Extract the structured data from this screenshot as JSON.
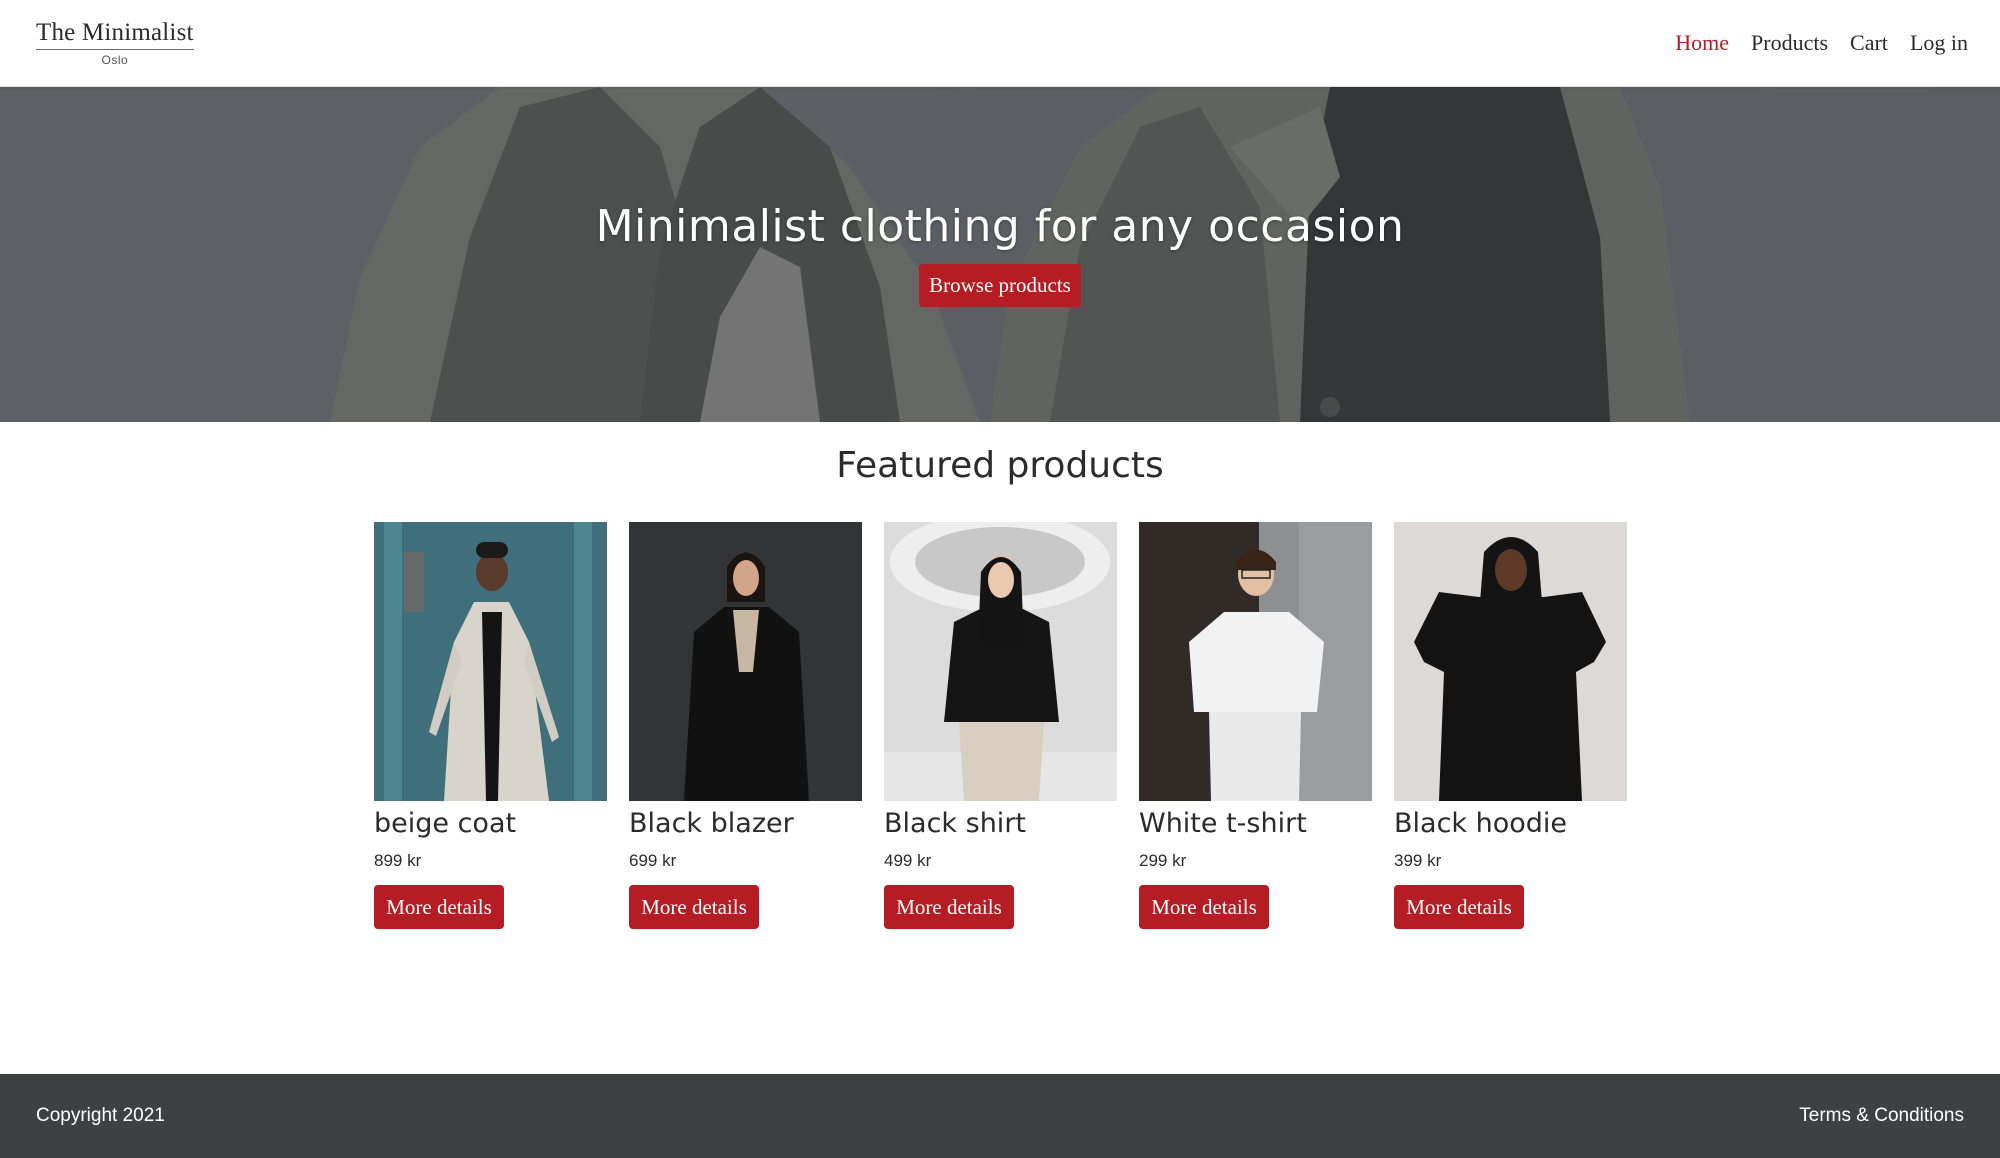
{
  "header": {
    "logo_name": "The Minimalist",
    "logo_city": "Oslo",
    "nav": [
      {
        "label": "Home",
        "active": true
      },
      {
        "label": "Products",
        "active": false
      },
      {
        "label": "Cart",
        "active": false
      },
      {
        "label": "Log in",
        "active": false
      }
    ]
  },
  "hero": {
    "title": "Minimalist clothing for any occasion",
    "button_label": "Browse products"
  },
  "featured": {
    "title": "Featured products",
    "products": [
      {
        "name": "beige coat",
        "price": "899 kr",
        "button_label": "More details"
      },
      {
        "name": "Black blazer",
        "price": "699 kr",
        "button_label": "More details"
      },
      {
        "name": "Black shirt",
        "price": "499 kr",
        "button_label": "More details"
      },
      {
        "name": "White t-shirt",
        "price": "299 kr",
        "button_label": "More details"
      },
      {
        "name": "Black hoodie",
        "price": "399 kr",
        "button_label": "More details"
      }
    ]
  },
  "footer": {
    "copyright": "Copyright 2021",
    "terms_label": "Terms & Conditions"
  },
  "colors": {
    "accent": "#b51c24",
    "footer_bg": "#3f4042",
    "text": "#2b2b2b"
  }
}
